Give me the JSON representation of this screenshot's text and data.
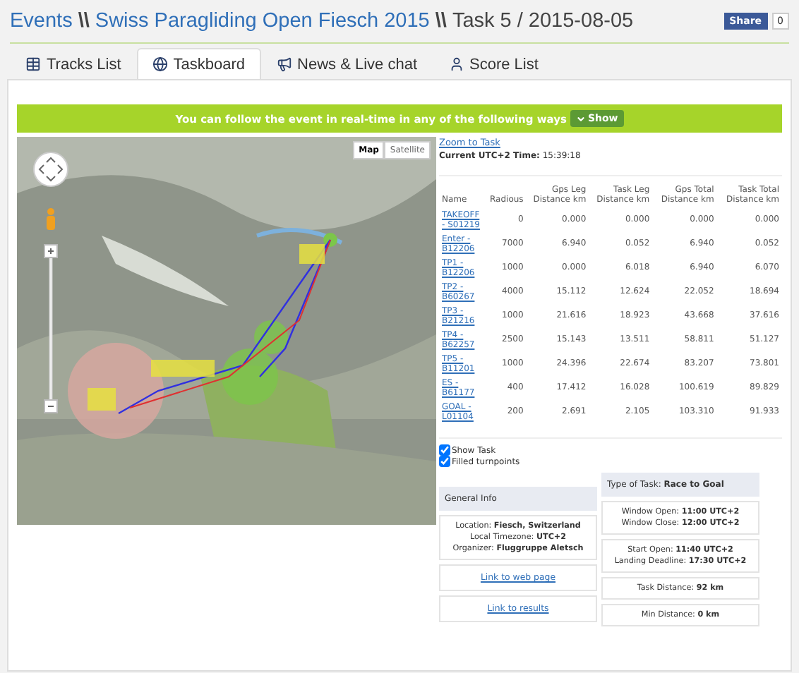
{
  "header": {
    "breadcrumb": [
      {
        "kind": "link",
        "text": "Events"
      },
      {
        "kind": "separator",
        "text": "\\\\"
      },
      {
        "kind": "link",
        "text": "Swiss Paragliding Open Fiesch 2015"
      },
      {
        "kind": "separator",
        "text": "\\\\"
      },
      {
        "kind": "plain",
        "text": "Task 5 / 2015-08-05"
      }
    ],
    "share": {
      "label": "Share",
      "count": "0"
    }
  },
  "tabs": [
    {
      "label": "Tracks List",
      "selected": false
    },
    {
      "label": "Taskboard",
      "selected": true
    },
    {
      "label": "News & Live chat",
      "selected": false
    },
    {
      "label": "Score List",
      "selected": false
    }
  ],
  "banner": {
    "text": "You can follow the event in real-time in any of the following ways",
    "button": "Show"
  },
  "map": {
    "types": [
      {
        "label": "Map",
        "selected": true
      },
      {
        "label": "Satellite",
        "selected": false
      }
    ]
  },
  "zoom_link": "Zoom to Task",
  "current_time": {
    "label": "Current UTC+2 Time:",
    "value": "15:39:18"
  },
  "table": {
    "columns": [
      "Name",
      "Radious",
      "Gps Leg Distance km",
      "Task Leg Distance km",
      "Gps Total Distance km",
      "Task Total Distance km"
    ],
    "rows": [
      [
        "TAKEOFF - S01219",
        "0",
        "0.000",
        "0.000",
        "0.000",
        "0.000"
      ],
      [
        "Enter - B12206",
        "7000",
        "6.940",
        "0.052",
        "6.940",
        "0.052"
      ],
      [
        "TP1 - B12206",
        "1000",
        "0.000",
        "6.018",
        "6.940",
        "6.070"
      ],
      [
        "TP2 - B60267",
        "4000",
        "15.112",
        "12.624",
        "22.052",
        "18.694"
      ],
      [
        "TP3 - B21216",
        "1000",
        "21.616",
        "18.923",
        "43.668",
        "37.616"
      ],
      [
        "TP4 - B62257",
        "2500",
        "15.143",
        "13.511",
        "58.811",
        "51.127"
      ],
      [
        "TP5 - B11201",
        "1000",
        "24.396",
        "22.674",
        "83.207",
        "73.801"
      ],
      [
        "ES - B61177",
        "400",
        "17.412",
        "16.028",
        "100.619",
        "89.829"
      ],
      [
        "GOAL - L01104",
        "200",
        "2.691",
        "2.105",
        "103.310",
        "91.933"
      ]
    ]
  },
  "options": [
    {
      "label": "Show Task",
      "checked": true
    },
    {
      "label": "Filled turnpoints",
      "checked": true
    }
  ],
  "general_info": {
    "title": "General Info",
    "lines": [
      "Location: **Fiesch, Switzerland**",
      "Local Timezone: **UTC+2**",
      "Organizer: **Fluggruppe Aletsch**"
    ],
    "links": [
      "Link to web page",
      "Link to results"
    ]
  },
  "task_info": {
    "title": "Type of Task: **Race to Goal**",
    "groups": [
      [
        "Window Open: **11:00 UTC+2**",
        "Window Close: **12:00 UTC+2**"
      ],
      [
        "Start Open: **11:40 UTC+2**",
        "Landing Deadline: **17:30 UTC+2**"
      ],
      [
        "Task Distance: **92 km**"
      ],
      [
        "Min Distance: **0 km**"
      ]
    ]
  }
}
